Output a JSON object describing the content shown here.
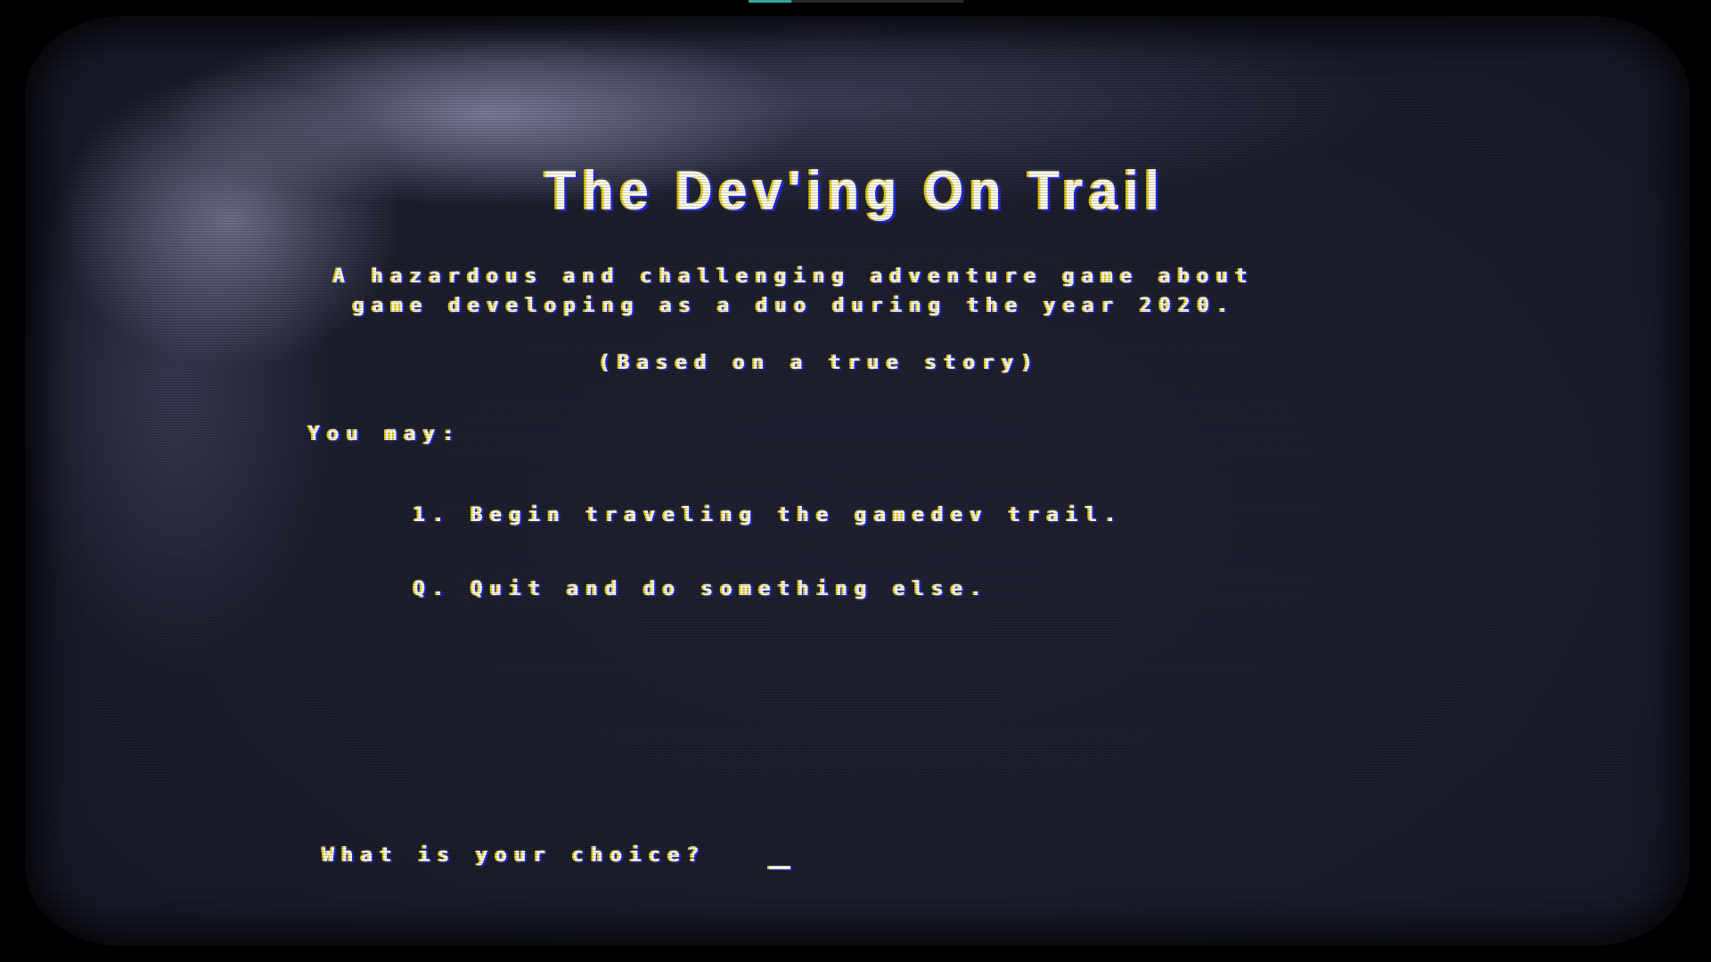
{
  "loading": {
    "progress_percent": 20,
    "fill_color": "#2fa6a0"
  },
  "screen": {
    "title": "The Dev'ing On Trail",
    "subtitle_line1": "A hazardous and challenging adventure game about",
    "subtitle_line2": "game developing as a duo during the year 2020.",
    "based_on": "(Based on a true story)",
    "menu_heading": "You may:",
    "options": [
      {
        "key": "1",
        "label": "1. Begin traveling the gamedev trail."
      },
      {
        "key": "Q",
        "label": "Q. Quit and do something else."
      }
    ],
    "prompt": "What is your choice?",
    "input_value": "",
    "cursor_char": "_"
  },
  "colors": {
    "text": "#fdfbe8",
    "fringe_left": "#e8d018",
    "fringe_right": "#2228d8",
    "screen_bg": "#1e1f30"
  }
}
